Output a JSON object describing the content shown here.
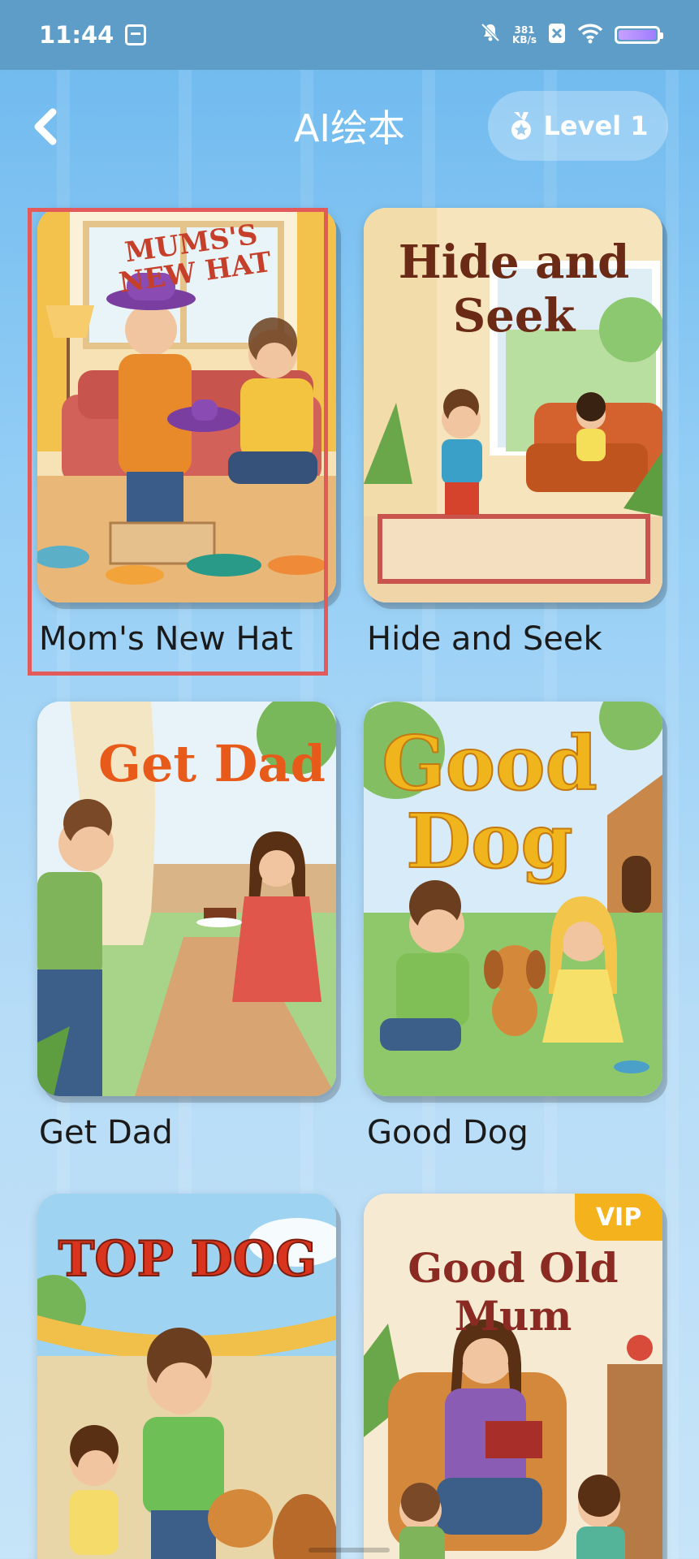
{
  "status_bar": {
    "time": "11:44",
    "net_speed_value": "381",
    "net_speed_unit": "KB/s"
  },
  "header": {
    "title": "AI绘本",
    "level_label": "Level 1"
  },
  "books": [
    {
      "title": "Mom's New Hat",
      "cover_text": "MUMS'S NEW HAT",
      "selected": true
    },
    {
      "title": "Hide and Seek",
      "cover_text": "Hide and Seek"
    },
    {
      "title": "Get Dad",
      "cover_text": "Get Dad"
    },
    {
      "title": "Good Dog",
      "cover_text": "Good Dog"
    },
    {
      "title": "",
      "cover_text": "TOP DOG"
    },
    {
      "title": "",
      "cover_text": "Good Old Mum",
      "badge": "VIP"
    }
  ],
  "colors": {
    "background_top": "#6cb8ee",
    "selection_border": "#e25a5a",
    "vip_badge": "#f4b21c"
  },
  "icons": [
    "back-arrow-icon",
    "medal-icon",
    "mute-icon",
    "wifi-icon",
    "battery-icon"
  ]
}
